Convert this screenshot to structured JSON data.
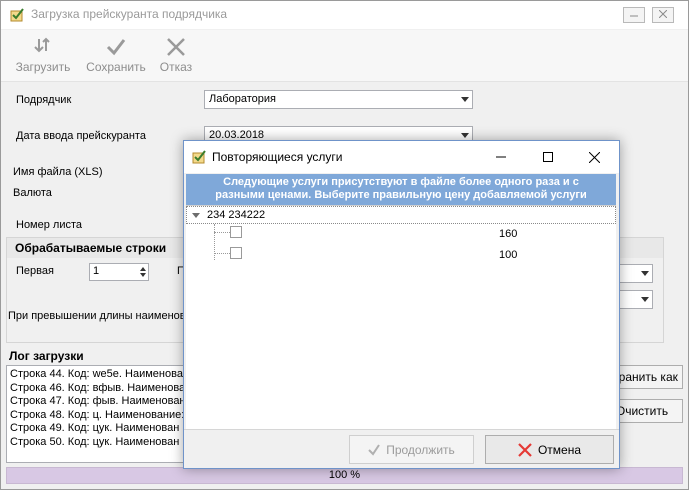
{
  "main": {
    "title": "Загрузка прейскуранта подрядчика",
    "toolbar": {
      "load_label": "Загрузить",
      "save_label": "Сохранить",
      "cancel_label": "Отказ"
    },
    "form": {
      "contractor_label": "Подрядчик",
      "contractor_value": "Лаборатория",
      "date_label": "Дата ввода прейскуранта",
      "date_value": "20.03.2018",
      "filename_label": "Имя файла (XLS)",
      "currency_label": "Валюта",
      "sheet_label": "Номер листа"
    },
    "rows_group": {
      "title": "Обрабатываемые строки",
      "first_label": "Первая",
      "first_value": "1",
      "partial_label": "П",
      "overflow_label": "При превышении длины наименова"
    },
    "log": {
      "title": "Лог загрузки",
      "lines": [
        "Строка 44. Код: we5e. Наименова",
        "Строка 46. Код: вфыв. Наименова",
        "Строка 47. Код: фыв. Наименован",
        "Строка 48. Код: ц. Наименование:",
        "Строка 49. Код: цук. Наименован",
        "Строка 50. Код: цук. Наименован"
      ]
    },
    "side_buttons": {
      "save_as_label": "охранить как",
      "clear_label": "Очистить"
    },
    "progress": {
      "percent": 100,
      "label": "100 %"
    }
  },
  "dialog": {
    "title": "Повторяющиеся услуги",
    "banner_line1": "Следующие услуги присутствуют в файле более одного раза и с",
    "banner_line2": "разными ценами. Выберите правильную цену добавляемой услуги",
    "group_name": "234 234222",
    "items": [
      {
        "checked": false,
        "price": "160"
      },
      {
        "checked": false,
        "price": "100"
      }
    ],
    "continue_label": "Продолжить",
    "cancel_label": "Отмена"
  },
  "colors": {
    "banner": "#7fa8d9",
    "progress": "#d8c8e4",
    "cancel_icon": "#e53935"
  }
}
